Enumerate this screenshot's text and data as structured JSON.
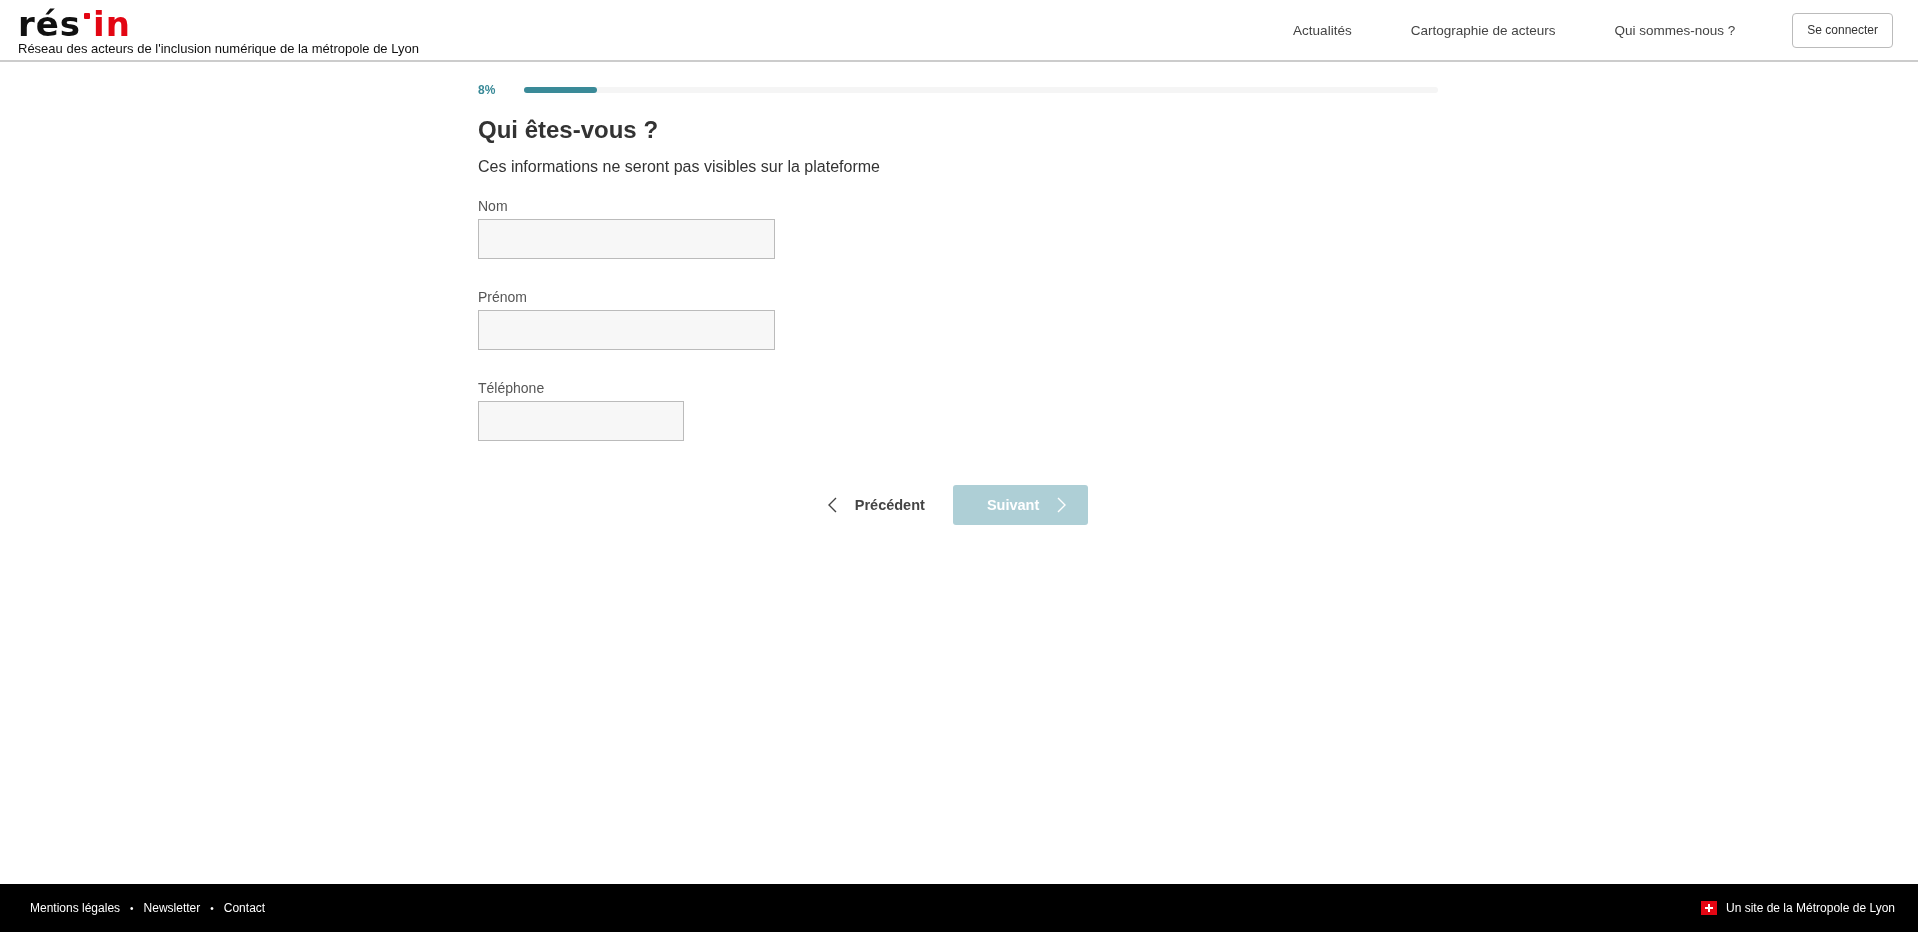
{
  "header": {
    "logo": {
      "part_1": "rés",
      "part_2": "in"
    },
    "tagline": "Réseau des acteurs de l'inclusion numérique de la métropole de Lyon",
    "nav": [
      "Actualités",
      "Cartographie de acteurs",
      "Qui sommes-nous ?"
    ],
    "login_button": "Se connecter"
  },
  "progress": {
    "reading": "8%",
    "level": 0.08
  },
  "form": {
    "title": "Qui êtes-vous ?",
    "subtitle": "Ces informations ne seront pas visibles sur la plateforme",
    "fields": [
      {
        "label": "Nom",
        "kind": "long"
      },
      {
        "label": "Prénom",
        "kind": "long"
      },
      {
        "label": "Téléphone",
        "kind": "short"
      }
    ],
    "back_button": "Précédent",
    "next_button": {
      "label": "Suivant",
      "disabled": true
    }
  },
  "footer": {
    "links": [
      "Mentions légales",
      "Newsletter",
      "Contact"
    ],
    "separator": "•",
    "credit": "Un site de la Métropole de Lyon"
  }
}
